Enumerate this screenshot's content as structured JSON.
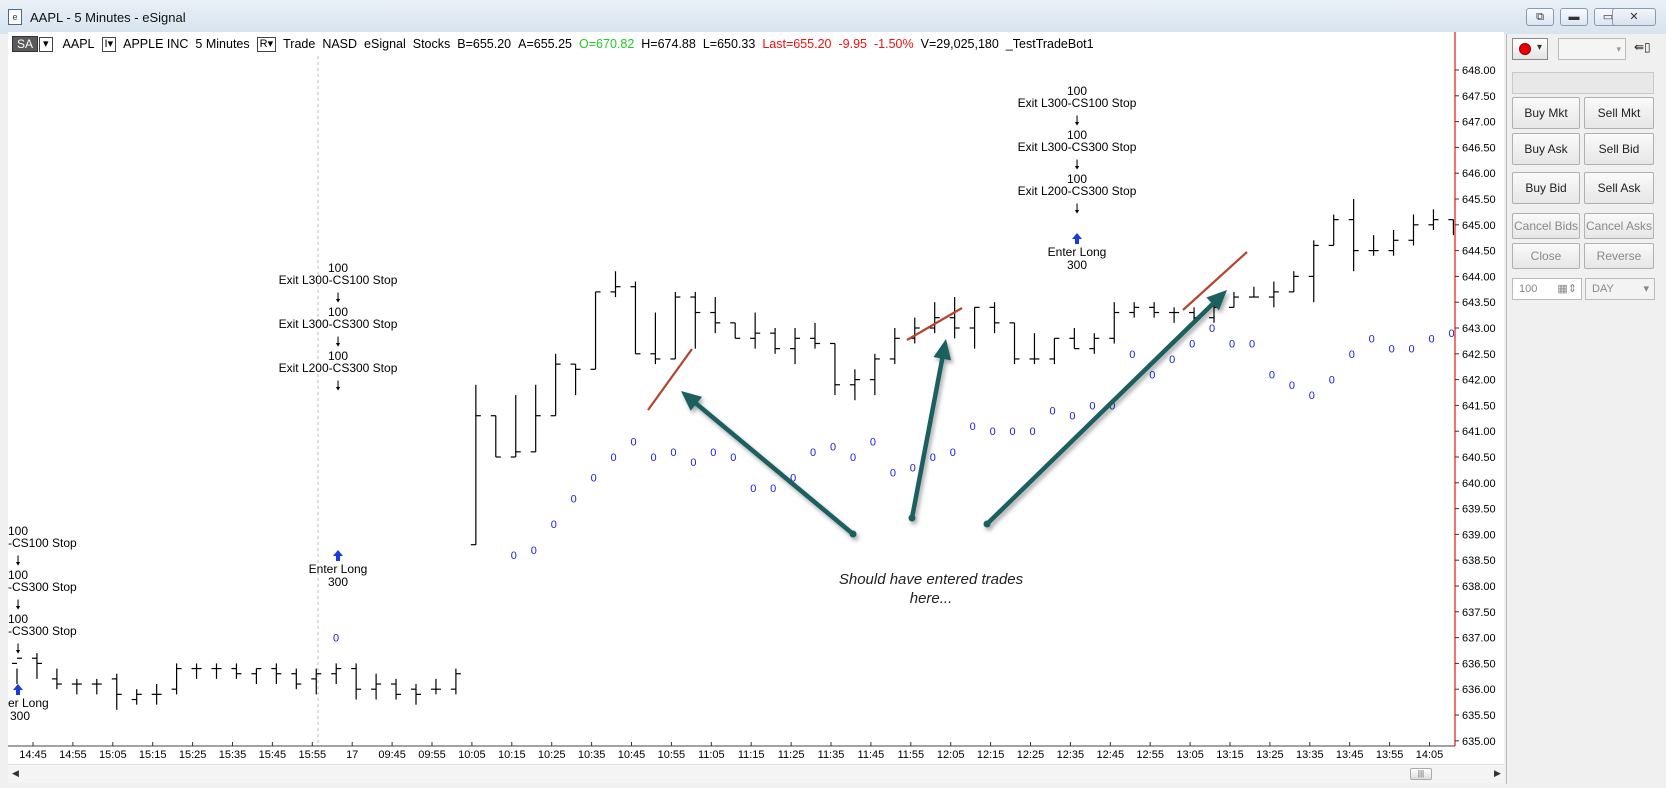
{
  "window": {
    "title": "AAPL - 5 Minutes - eSignal"
  },
  "infobar": {
    "sa": "SA",
    "symbol": "AAPL",
    "interval_btn": "I",
    "name": "APPLE INC",
    "period": "5 Minutes",
    "r_btn": "R",
    "type": "Trade",
    "exchange": "NASD",
    "feed": "eSignal",
    "asset": "Stocks",
    "bid": "B=655.20",
    "ask": "A=655.25",
    "open": "O=670.82",
    "high": "H=674.88",
    "low": "L=650.33",
    "last": "Last=655.20",
    "change": "-9.95",
    "pct": "-1.50%",
    "volume": "V=29,025,180",
    "study": "_TestTradeBot1"
  },
  "colors": {
    "bar": "#000000",
    "sar": "#1a1adf",
    "arrow": "#1e5e5e",
    "redline": "#b5452c",
    "axis_red": "#ee1111"
  },
  "labels": {
    "n100": "100",
    "exit1": "Exit L300-CS100 Stop",
    "exit2": "Exit L300-CS300 Stop",
    "exit3": "Exit L200-CS300 Stop",
    "exit1_cut": "-CS100 Stop",
    "exit2_cut": "-CS300 Stop",
    "exit3_cut": "-CS300 Stop",
    "enter": "Enter Long",
    "enter_cut": "er Long",
    "n300": "300",
    "zero": "0"
  },
  "annotation": {
    "line1": "Should have entered trades",
    "line2": "here..."
  },
  "panel": {
    "buy_mkt": "Buy Mkt",
    "sell_mkt": "Sell Mkt",
    "buy_ask": "Buy Ask",
    "sell_bid": "Sell Bid",
    "buy_bid": "Buy Bid",
    "sell_ask": "Sell Ask",
    "cancel_bids": "Cancel Bids",
    "cancel_asks": "Cancel Asks",
    "close": "Close",
    "reverse": "Reverse",
    "qty": "100",
    "tif": "DAY"
  },
  "chart_data": {
    "type": "ohlc",
    "symbol": "AAPL",
    "interval": "5 Minutes",
    "y_ticks": [
      "648.00",
      "647.50",
      "647.00",
      "646.50",
      "646.00",
      "645.50",
      "645.00",
      "644.50",
      "644.00",
      "643.50",
      "643.00",
      "642.50",
      "642.00",
      "641.50",
      "641.00",
      "640.50",
      "640.00",
      "639.50",
      "639.00",
      "638.50",
      "638.00",
      "637.50",
      "637.00",
      "636.50",
      "636.00",
      "635.50",
      "635.00"
    ],
    "x_ticks": [
      "14:45",
      "14:55",
      "15:05",
      "15:15",
      "15:25",
      "15:35",
      "15:45",
      "15:55",
      "17",
      "09:45",
      "09:55",
      "10:05",
      "10:15",
      "10:25",
      "10:35",
      "10:45",
      "10:55",
      "11:05",
      "11:15",
      "11:25",
      "11:35",
      "11:45",
      "11:55",
      "12:05",
      "12:15",
      "12:25",
      "12:35",
      "12:45",
      "12:55",
      "13:05",
      "13:15",
      "13:25",
      "13:35",
      "13:45",
      "13:55",
      "14:05"
    ],
    "ylim": [
      634.9,
      648.4
    ],
    "bars": [
      [
        636.5,
        636.4,
        636.1,
        636.6
      ],
      [
        636.6,
        636.7,
        636.2,
        636.5
      ],
      [
        636.2,
        636.4,
        636.0,
        636.1
      ],
      [
        636.1,
        636.2,
        635.9,
        636.1
      ],
      [
        636.1,
        636.2,
        635.9,
        636.1
      ],
      [
        636.2,
        636.3,
        635.6,
        635.9
      ],
      [
        635.8,
        636.0,
        635.7,
        635.9
      ],
      [
        635.9,
        636.1,
        635.7,
        635.9
      ],
      [
        636.0,
        636.5,
        635.9,
        636.4
      ],
      [
        636.4,
        636.5,
        636.2,
        636.4
      ],
      [
        636.4,
        636.5,
        636.2,
        636.4
      ],
      [
        636.4,
        636.5,
        636.2,
        636.3
      ],
      [
        636.3,
        636.4,
        636.1,
        636.4
      ],
      [
        636.4,
        636.5,
        636.1,
        636.3
      ],
      [
        636.3,
        636.4,
        636.0,
        636.1
      ],
      [
        636.2,
        636.4,
        635.9,
        636.3
      ],
      [
        636.3,
        636.5,
        636.1,
        636.4
      ],
      [
        636.4,
        636.5,
        635.8,
        636.0
      ],
      [
        636.0,
        636.3,
        635.8,
        636.1
      ],
      [
        636.1,
        636.2,
        635.8,
        635.9
      ],
      [
        636.0,
        636.1,
        635.7,
        635.9
      ],
      [
        636.0,
        636.2,
        635.9,
        636.0
      ],
      [
        636.0,
        636.4,
        635.9,
        636.3
      ],
      [
        638.8,
        641.9,
        638.8,
        641.3
      ],
      [
        641.3,
        641.3,
        640.5,
        640.5
      ],
      [
        640.5,
        641.7,
        640.5,
        640.6
      ],
      [
        640.6,
        641.9,
        640.6,
        641.3
      ],
      [
        641.3,
        642.5,
        641.3,
        642.3
      ],
      [
        642.3,
        642.3,
        641.7,
        642.2
      ],
      [
        642.2,
        643.7,
        642.2,
        643.7
      ],
      [
        643.7,
        644.1,
        643.6,
        643.8
      ],
      [
        643.8,
        643.9,
        642.5,
        642.5
      ],
      [
        642.5,
        643.3,
        642.3,
        642.4
      ],
      [
        642.4,
        643.7,
        642.4,
        643.6
      ],
      [
        643.6,
        643.7,
        642.6,
        643.3
      ],
      [
        643.3,
        643.6,
        642.9,
        643.1
      ],
      [
        643.1,
        643.1,
        642.8,
        642.8
      ],
      [
        642.8,
        643.3,
        642.6,
        642.9
      ],
      [
        642.9,
        643.0,
        642.5,
        642.6
      ],
      [
        642.6,
        643.0,
        642.3,
        642.8
      ],
      [
        642.8,
        643.1,
        642.6,
        642.7
      ],
      [
        642.7,
        642.7,
        641.7,
        641.9
      ],
      [
        641.9,
        642.2,
        641.6,
        642.0
      ],
      [
        642.0,
        642.5,
        641.7,
        642.4
      ],
      [
        642.4,
        643.0,
        642.3,
        642.8
      ],
      [
        642.8,
        643.2,
        642.7,
        643.0
      ],
      [
        643.0,
        643.5,
        642.9,
        643.2
      ],
      [
        643.2,
        643.6,
        642.8,
        643.0
      ],
      [
        643.0,
        643.4,
        642.6,
        643.4
      ],
      [
        643.4,
        643.5,
        642.9,
        643.1
      ],
      [
        643.1,
        643.1,
        642.3,
        642.4
      ],
      [
        642.4,
        642.9,
        642.3,
        642.4
      ],
      [
        642.4,
        642.8,
        642.3,
        642.8
      ],
      [
        642.8,
        643.0,
        642.6,
        642.6
      ],
      [
        642.6,
        642.9,
        642.5,
        642.8
      ],
      [
        642.8,
        643.5,
        642.7,
        643.3
      ],
      [
        643.3,
        643.5,
        643.2,
        643.4
      ],
      [
        643.4,
        643.5,
        643.2,
        643.3
      ],
      [
        643.3,
        643.4,
        643.1,
        643.3
      ],
      [
        643.3,
        643.4,
        643.1,
        643.2
      ],
      [
        643.2,
        643.5,
        643.1,
        643.4
      ],
      [
        643.4,
        643.7,
        643.4,
        643.6
      ],
      [
        643.6,
        643.8,
        643.6,
        643.6
      ],
      [
        643.6,
        643.9,
        643.4,
        643.7
      ],
      [
        643.7,
        644.1,
        643.7,
        644.0
      ],
      [
        644.0,
        644.7,
        643.5,
        644.6
      ],
      [
        644.6,
        645.2,
        644.6,
        645.1
      ],
      [
        645.1,
        645.5,
        644.1,
        644.5
      ],
      [
        644.5,
        644.8,
        644.4,
        644.5
      ],
      [
        644.5,
        644.9,
        644.4,
        644.7
      ],
      [
        644.7,
        645.2,
        644.6,
        645.0
      ],
      [
        645.0,
        645.3,
        644.9,
        645.1
      ],
      [
        645.1,
        645.1,
        644.8,
        644.9
      ],
      [
        644.9,
        645.1,
        644.8,
        645.0
      ],
      [
        645.0,
        645.0,
        644.2,
        644.3
      ],
      [
        644.3,
        644.6,
        644.0,
        644.2
      ],
      [
        644.2,
        644.3,
        643.9,
        644.1
      ],
      [
        644.1,
        644.4,
        643.7,
        644.2
      ],
      [
        644.2,
        644.7,
        644.1,
        644.6
      ],
      [
        644.6,
        644.8,
        644.5,
        644.7
      ],
      [
        644.7,
        645.2,
        644.6,
        645.1
      ],
      [
        645.1,
        645.2,
        644.7,
        645.0
      ],
      [
        645.0,
        645.2,
        644.5,
        644.6
      ],
      [
        644.6,
        644.9,
        644.6,
        644.8
      ],
      [
        644.8,
        645.0,
        644.7,
        644.9
      ],
      [
        644.9,
        645.0,
        644.7,
        644.9
      ],
      [
        644.9,
        645.1,
        644.8,
        645.0
      ],
      [
        645.0,
        645.1,
        644.8,
        644.9
      ],
      [
        644.9,
        645.2,
        644.7,
        644.8
      ],
      [
        644.8,
        645.0,
        644.8,
        644.9
      ],
      [
        644.9,
        645.0,
        644.8,
        644.9
      ],
      [
        644.9,
        645.0,
        644.8,
        644.8
      ],
      [
        644.8,
        645.0,
        644.8,
        644.9
      ],
      [
        644.9,
        644.9,
        644.6,
        644.8
      ],
      [
        644.8,
        644.8,
        644.5,
        644.5
      ]
    ],
    "sar": [
      638.6,
      638.7,
      639.2,
      639.7,
      640.1,
      640.5,
      640.8,
      640.5,
      640.6,
      640.4,
      640.6,
      640.5,
      639.9,
      639.9,
      640.1,
      640.6,
      640.7,
      640.5,
      640.8,
      640.2,
      640.3,
      640.5,
      640.6,
      641.1,
      641.0,
      641.0,
      641.0,
      641.4,
      641.3,
      641.5,
      641.5,
      642.5,
      642.1,
      642.4,
      642.7,
      643.0,
      642.7,
      642.7,
      642.1,
      641.9,
      641.7,
      642.0,
      642.5,
      642.8,
      642.6,
      642.6,
      642.8,
      642.9,
      642.8,
      642.8,
      642.9,
      642.8,
      642.7,
      642.6
    ],
    "sar_outlier": 637.0
  }
}
